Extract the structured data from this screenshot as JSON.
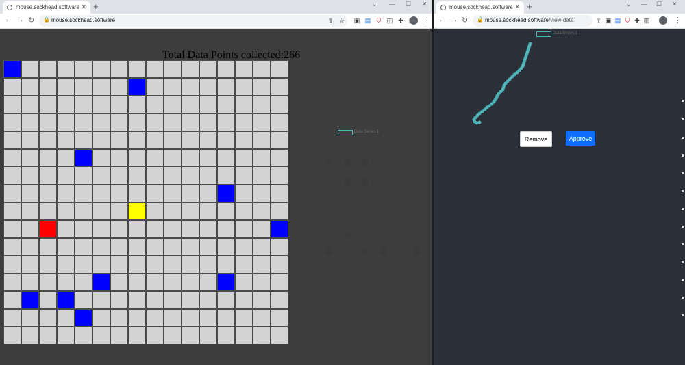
{
  "left_window": {
    "tab_title": "mouse.sockhead.software",
    "url": "mouse.sockhead.software",
    "counter_label": "Total Data Points collected:",
    "counter_value": "266",
    "legend_label": "Data Series 1",
    "grid": {
      "rows": 16,
      "cols": 16,
      "colors": {
        "empty": "#d3d3d3",
        "blue": "#0000ff",
        "red": "#ff0000",
        "yellow": "#ffff00"
      },
      "blue_cells": [
        [
          0,
          0
        ],
        [
          1,
          7
        ],
        [
          5,
          4
        ],
        [
          7,
          12
        ],
        [
          9,
          15
        ],
        [
          12,
          5
        ],
        [
          12,
          12
        ],
        [
          13,
          1
        ],
        [
          13,
          3
        ],
        [
          14,
          4
        ]
      ],
      "red_cells": [
        [
          9,
          2
        ]
      ],
      "yellow_cells": [
        [
          8,
          7
        ]
      ]
    }
  },
  "right_window": {
    "tab_title": "mouse.sockhead.software/view-data",
    "url_host": "mouse.sockhead.software",
    "url_path": "/view-data",
    "legend_label": "Data Series 1",
    "remove_label": "Remove",
    "approve_label": "Approve",
    "line_color": "#4fb6ba"
  },
  "chart_data": {
    "type": "line",
    "series": [
      {
        "name": "Data Series 1",
        "points": [
          [
            774,
            64
          ],
          [
            773,
            67
          ],
          [
            772,
            70
          ],
          [
            771,
            73
          ],
          [
            770,
            76
          ],
          [
            769,
            79
          ],
          [
            768,
            82
          ],
          [
            767,
            85
          ],
          [
            766,
            88
          ],
          [
            765,
            91
          ],
          [
            764,
            94
          ],
          [
            763,
            97
          ],
          [
            761,
            100
          ],
          [
            758,
            103
          ],
          [
            755,
            106
          ],
          [
            751,
            109
          ],
          [
            748,
            112
          ],
          [
            744,
            116
          ],
          [
            741,
            119
          ],
          [
            738,
            122
          ],
          [
            736,
            125
          ],
          [
            735,
            128
          ],
          [
            734,
            131
          ],
          [
            731,
            134
          ],
          [
            728,
            137
          ],
          [
            726,
            140
          ],
          [
            725,
            143
          ],
          [
            723,
            146
          ],
          [
            721,
            149
          ],
          [
            718,
            152
          ],
          [
            714,
            155
          ],
          [
            711,
            157
          ],
          [
            708,
            160
          ],
          [
            704,
            163
          ],
          [
            700,
            166
          ],
          [
            697,
            169
          ],
          [
            694,
            172
          ],
          [
            692,
            175
          ],
          [
            693,
            178
          ],
          [
            696,
            180
          ],
          [
            700,
            179
          ]
        ]
      }
    ]
  }
}
